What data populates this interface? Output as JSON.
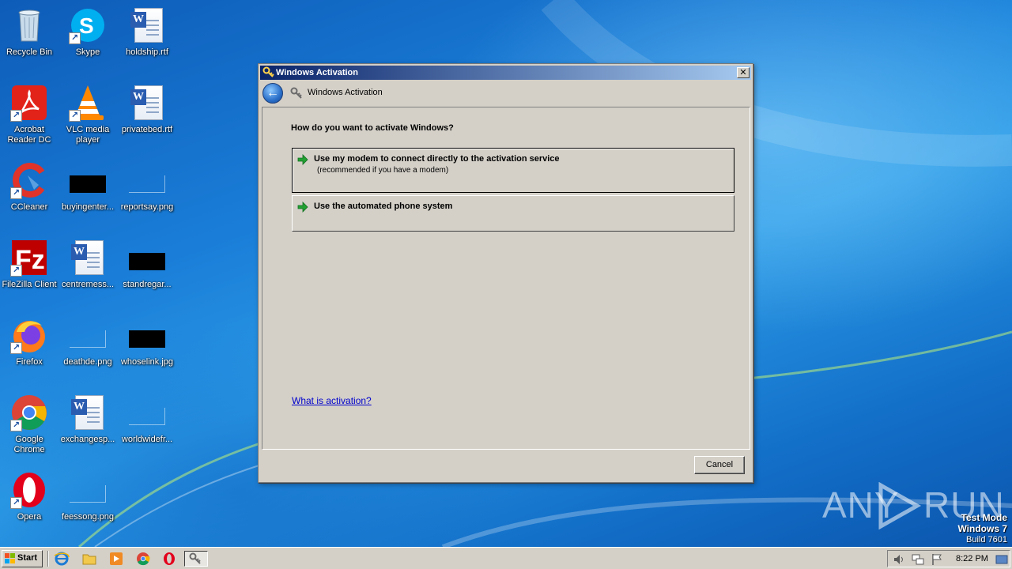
{
  "desktop": {
    "icons": [
      {
        "label": "Recycle Bin",
        "icon": "recycle-bin-icon"
      },
      {
        "label": "Skype",
        "icon": "skype-icon"
      },
      {
        "label": "holdship.rtf",
        "icon": "word-document-icon"
      },
      {
        "label": "Acrobat Reader DC",
        "icon": "acrobat-reader-icon"
      },
      {
        "label": "VLC media player",
        "icon": "vlc-icon"
      },
      {
        "label": "privatebed.rtf",
        "icon": "word-document-icon"
      },
      {
        "label": "CCleaner",
        "icon": "ccleaner-icon"
      },
      {
        "label": "buyingenter...",
        "icon": "image-file-icon"
      },
      {
        "label": "reportsay.png",
        "icon": "image-file-icon"
      },
      {
        "label": "FileZilla Client",
        "icon": "filezilla-icon"
      },
      {
        "label": "centremess...",
        "icon": "word-document-icon"
      },
      {
        "label": "standregar...",
        "icon": "image-file-icon"
      },
      {
        "label": "Firefox",
        "icon": "firefox-icon"
      },
      {
        "label": "deathde.png",
        "icon": "image-file-icon"
      },
      {
        "label": "whoselink.jpg",
        "icon": "image-file-icon"
      },
      {
        "label": "Google Chrome",
        "icon": "chrome-icon"
      },
      {
        "label": "exchangesp...",
        "icon": "word-document-icon"
      },
      {
        "label": "worldwidefr...",
        "icon": "image-file-icon"
      },
      {
        "label": "Opera",
        "icon": "opera-icon"
      },
      {
        "label": "feessong.png",
        "icon": "image-file-icon"
      }
    ]
  },
  "dialog": {
    "title": "Windows Activation",
    "nav_title": "Windows Activation",
    "question": "How do you want to activate Windows?",
    "options": [
      {
        "title": "Use my modem to connect directly to the activation service",
        "subtitle": "(recommended if you have a modem)",
        "selected": true
      },
      {
        "title": "Use the automated phone system",
        "subtitle": "",
        "selected": false
      }
    ],
    "help_link": "What is activation?",
    "cancel_label": "Cancel",
    "close_glyph": "✕",
    "back_glyph": "←"
  },
  "watermark": {
    "brand_left": "ANY",
    "brand_right": "RUN",
    "test_mode": "Test Mode",
    "os": "Windows 7",
    "build": "Build 7601"
  },
  "taskbar": {
    "start_label": "Start",
    "clock": "8:22 PM",
    "pinned": [
      "internet-explorer-icon",
      "explorer-folder-icon",
      "media-player-icon",
      "chrome-icon",
      "opera-icon",
      "activation-key-icon"
    ]
  },
  "colors": {
    "titlebar_start": "#0a246a",
    "titlebar_end": "#a6caf0",
    "dialog_face": "#d4d0c8",
    "link": "#0000cc",
    "arrow_green": "#22a032"
  }
}
